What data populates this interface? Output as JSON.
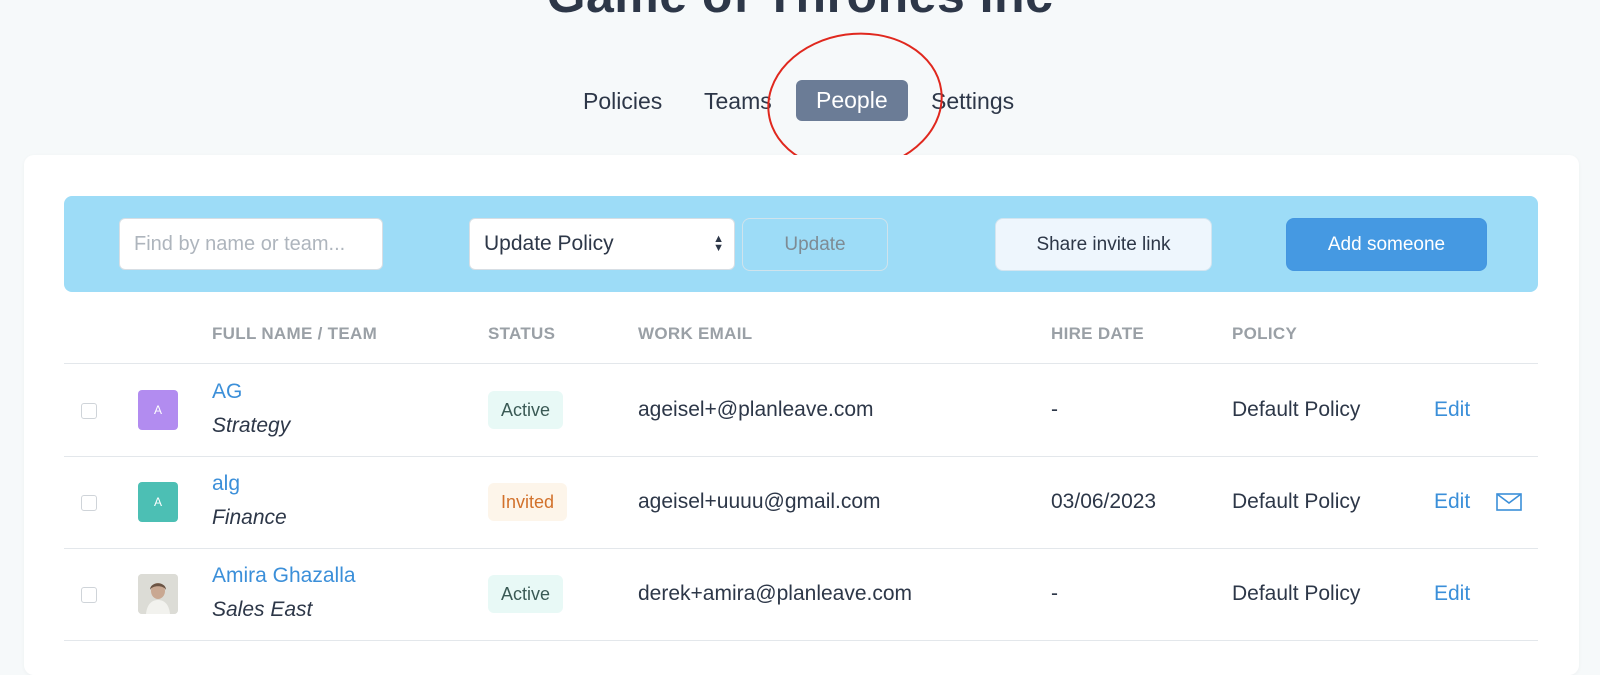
{
  "company": {
    "title": "Game of Thrones Inc"
  },
  "nav": {
    "tabs": [
      "Policies",
      "Teams",
      "People",
      "Settings"
    ],
    "active": "People"
  },
  "toolbar": {
    "search_placeholder": "Find by name or team...",
    "policy_select_value": "Update Policy",
    "update_label": "Update",
    "share_label": "Share invite link",
    "add_label": "Add someone"
  },
  "table": {
    "headers": [
      "FULL NAME / TEAM",
      "STATUS",
      "WORK EMAIL",
      "HIRE DATE",
      "POLICY"
    ],
    "edit_label": "Edit",
    "rows": [
      {
        "initial": "A",
        "avatar_color": "#b28cf0",
        "name": "AG",
        "team": "Strategy",
        "status": "Active",
        "email": "ageisel+@planleave.com",
        "hire_date": "-",
        "policy": "Default Policy",
        "mail_icon": false
      },
      {
        "initial": "A",
        "avatar_color": "#4cbfb4",
        "name": "alg",
        "team": "Finance",
        "status": "Invited",
        "email": "ageisel+uuuu@gmail.com",
        "hire_date": "03/06/2023",
        "policy": "Default Policy",
        "mail_icon": true
      },
      {
        "initial": "",
        "avatar_color": "photo",
        "name": "Amira Ghazalla",
        "team": "Sales East",
        "status": "Active",
        "email": "derek+amira@planleave.com",
        "hire_date": "-",
        "policy": "Default Policy",
        "mail_icon": false
      }
    ]
  },
  "colors": {
    "accent": "#4599e2",
    "toolbar_bg": "#9ddcf7",
    "active_tab_bg": "#6b7c96",
    "link": "#3b8fd9",
    "annotation": "#e0281e"
  }
}
